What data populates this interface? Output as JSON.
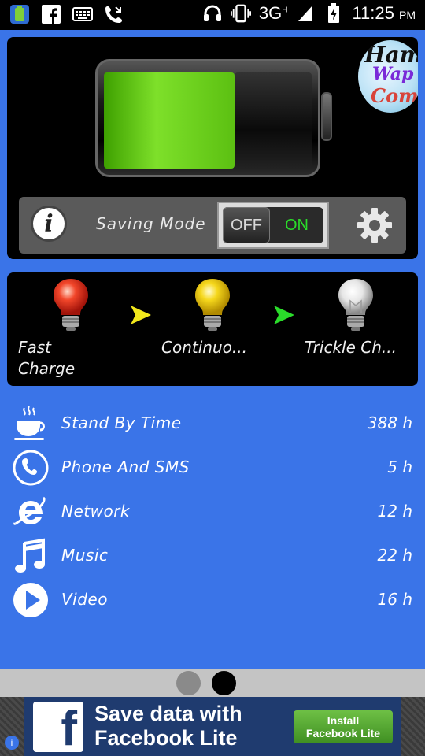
{
  "status_bar": {
    "left_icons": [
      "app-icon",
      "facebook-icon",
      "keyboard-icon",
      "missed-call-icon"
    ],
    "right_icons": [
      "headset-icon",
      "vibrate-icon"
    ],
    "network": "3G",
    "network_sup": "H",
    "time": "11:25",
    "ampm": "PM"
  },
  "battery": {
    "level": 0.63,
    "fill_color": "#6fd51f",
    "logo_lines": [
      "Ham",
      "Wap",
      "Com"
    ]
  },
  "mode_bar": {
    "info_glyph": "i",
    "label": "Saving Mode",
    "switch_off": "OFF",
    "switch_on": "ON",
    "switch_state": "on"
  },
  "charge_stages": [
    {
      "label_line1": "Fast",
      "label_line2": "Charge",
      "bulb_color": "#e8321a"
    },
    {
      "label_line1": "Continuo...",
      "label_line2": "",
      "bulb_color": "#f2d21c"
    },
    {
      "label_line1": "Trickle Ch...",
      "label_line2": "",
      "bulb_color": "#e6e6e6"
    }
  ],
  "arrow_colors": [
    "#f2e81c",
    "#2adc2a"
  ],
  "usage": [
    {
      "icon": "coffee-cup-icon",
      "label": "Stand By Time",
      "value": "388 h"
    },
    {
      "icon": "phone-icon",
      "label": "Phone And SMS",
      "value": "5 h"
    },
    {
      "icon": "internet-explorer-icon",
      "label": "Network",
      "value": "12 h"
    },
    {
      "icon": "music-note-icon",
      "label": "Music",
      "value": "22 h"
    },
    {
      "icon": "play-icon",
      "label": "Video",
      "value": "16 h"
    }
  ],
  "pager": {
    "pages": 2,
    "active": 1
  },
  "ad": {
    "title_line1": "Save data with",
    "title_line2": "Facebook Lite",
    "cta_line1": "Install",
    "cta_line2": "Facebook Lite",
    "logo_letter": "f",
    "info_glyph": "i"
  }
}
